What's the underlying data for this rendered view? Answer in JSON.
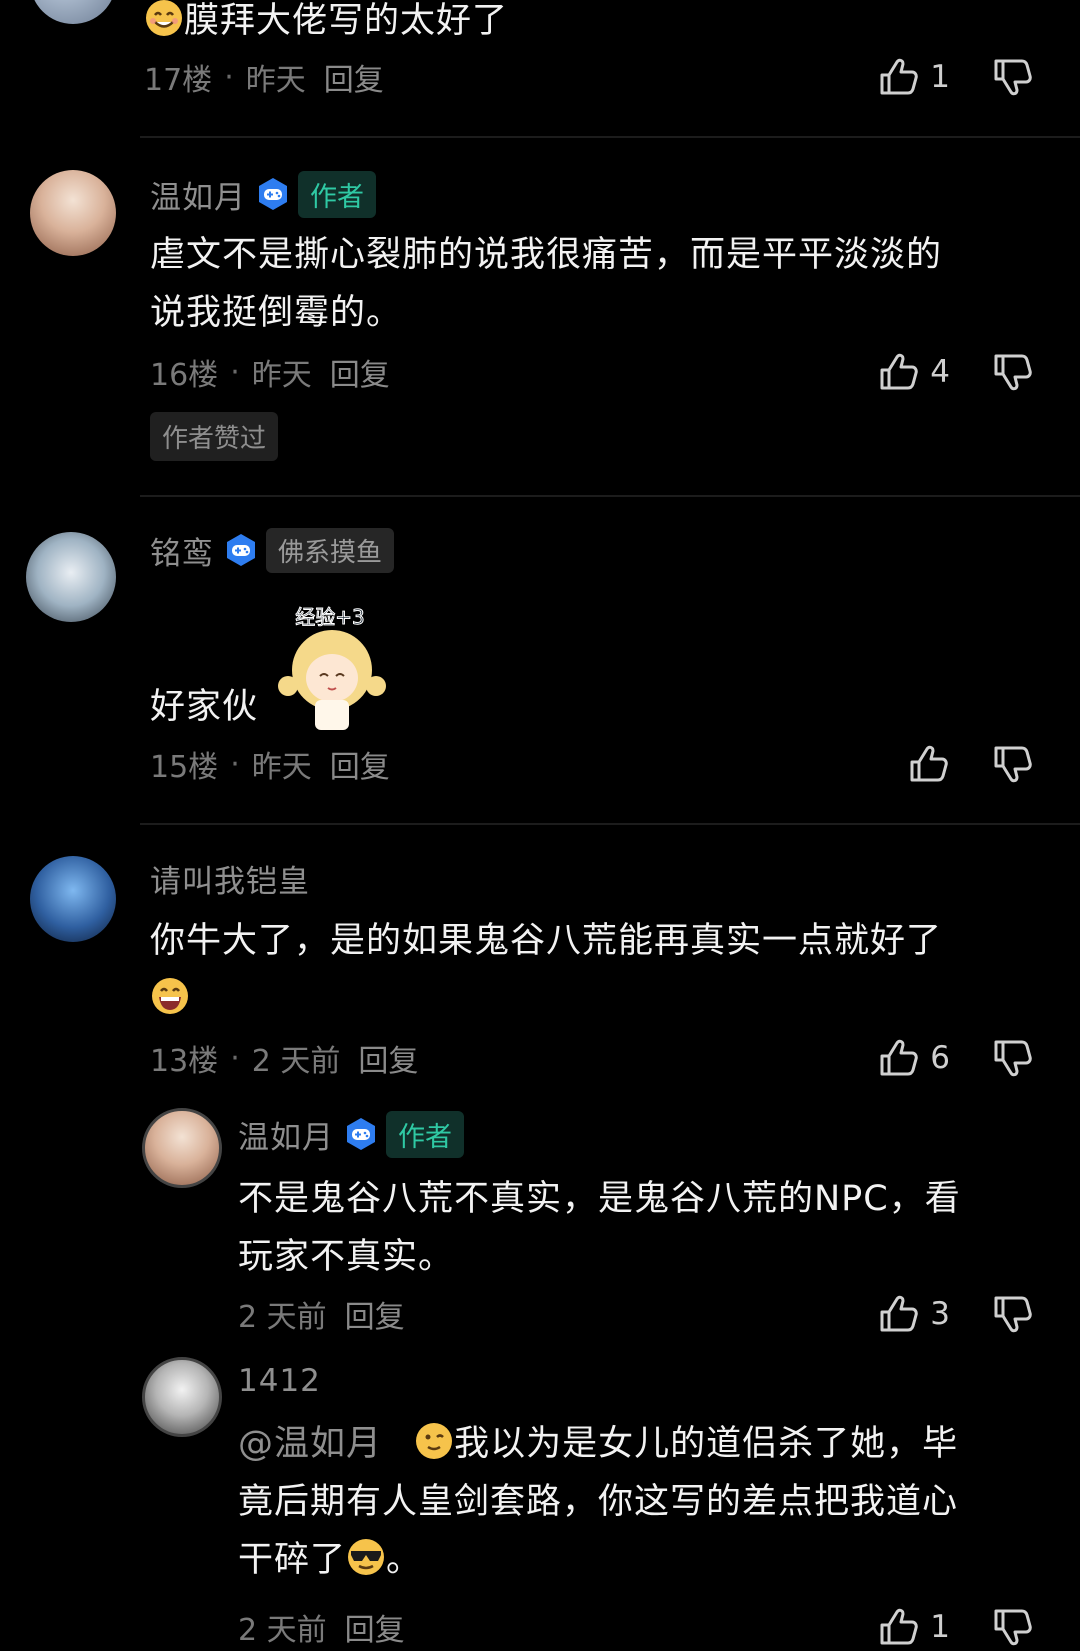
{
  "comments": [
    {
      "text": "膜拜大佬写的太好了",
      "floor": "17楼",
      "time": "昨天",
      "reply": "回复",
      "likes": "1"
    },
    {
      "user": "温如月",
      "tag": "作者",
      "text_line1": "虐文不是撕心裂肺的说我很痛苦，而是平平淡淡的",
      "text_line2": "说我挺倒霉的。",
      "floor": "16楼",
      "time": "昨天",
      "reply": "回复",
      "likes": "4",
      "author_liked": "作者赞过"
    },
    {
      "user": "铭鸾",
      "tag": "佛系摸鱼",
      "text": "好家伙",
      "floor": "15楼",
      "time": "昨天",
      "reply": "回复"
    },
    {
      "user": "请叫我铠皇",
      "text_line1": "你牛大了，是的如果鬼谷八荒能再真实一点就好了",
      "floor": "13楼",
      "time": "2 天前",
      "reply": "回复",
      "likes": "6"
    }
  ],
  "replies": [
    {
      "user": "温如月",
      "tag": "作者",
      "text_line1": "不是鬼谷八荒不真实，是鬼谷八荒的NPC，看",
      "text_line2": "玩家不真实。",
      "time": "2 天前",
      "reply": "回复",
      "likes": "3"
    },
    {
      "user": "1412",
      "mention": "@温如月",
      "text_line1": "我以为是女儿的道侣杀了她，毕",
      "text_line2": "竟后期有人皇剑套路，你这写的差点把我道心",
      "text_line3": "干碎了",
      "text_line3_end": "。",
      "time": "2 天前",
      "reply": "回复",
      "likes": "1"
    }
  ],
  "sticker_text": "经验+3"
}
